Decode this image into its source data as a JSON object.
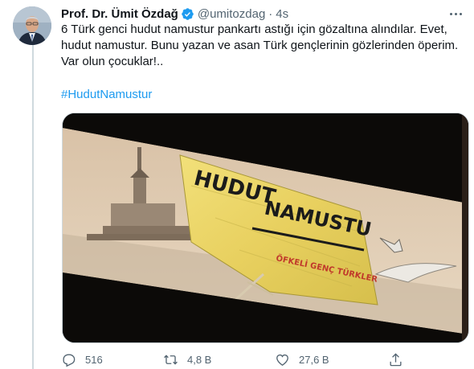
{
  "tweet": {
    "author_name": "Prof. Dr. Ümit Özdağ",
    "handle": "@umitozdag",
    "separator": "·",
    "time": "4s",
    "text_lines": [
      "6 Türk genci hudut namustur pankartı astığı için gözaltına alındılar. Evet,",
      "hudut namustur. Bunu yazan ve asan Türk gençlerinin gözlerinden öperim.",
      "Var olun çocuklar!.."
    ],
    "hashtag": "#HudutNamustur"
  },
  "media": {
    "banner_text_line1": "HUDUT",
    "banner_text_line2": "NAMUSTU",
    "banner_small_text": "ÖFKELİ GENÇ TÜRKLER"
  },
  "actions": {
    "reply_count": "516",
    "retweet_count": "4,8 B",
    "like_count": "27,6 B"
  },
  "icons": {
    "verified": "verified-badge-icon",
    "more": "more-icon",
    "reply": "reply-icon",
    "retweet": "retweet-icon",
    "like": "heart-icon",
    "share": "share-icon"
  },
  "colors": {
    "accent": "#1d9bf0",
    "text": "#0f1419",
    "secondary": "#536471"
  }
}
